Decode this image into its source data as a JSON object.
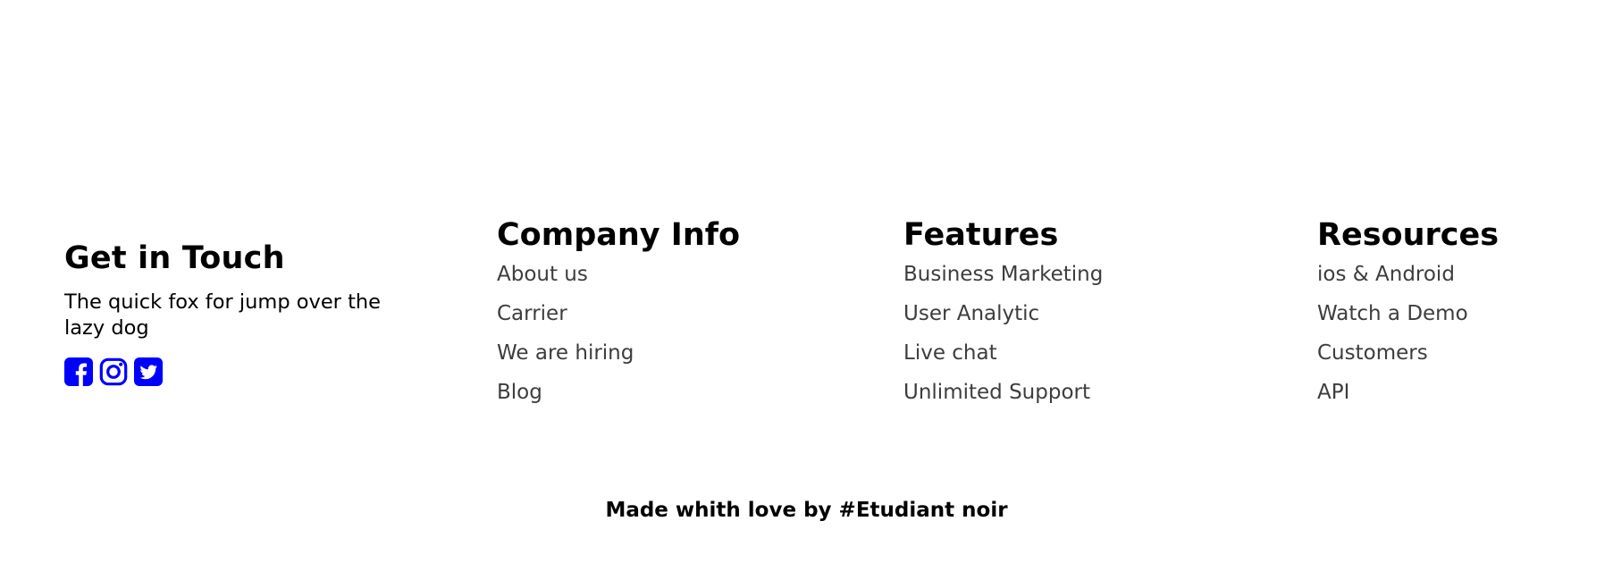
{
  "contact": {
    "title": "Get in Touch",
    "text": "The quick fox for jump over the lazy dog",
    "social_icons": [
      "facebook-icon",
      "instagram-icon",
      "twitter-icon"
    ]
  },
  "columns": [
    {
      "title": "Company Info",
      "links": [
        "About us",
        "Carrier",
        "We are hiring",
        "Blog"
      ]
    },
    {
      "title": "Features",
      "links": [
        "Business Marketing",
        "User Analytic",
        "Live chat",
        "Unlimited Support"
      ]
    },
    {
      "title": "Resources",
      "links": [
        "ios & Android",
        "Watch a Demo",
        "Customers",
        "API"
      ]
    }
  ],
  "credits": "Made whith love by #Etudiant noir",
  "colors": {
    "accent": "#0000ff",
    "link": "#3d3d3d",
    "text": "#000000",
    "background": "#ffffff"
  }
}
